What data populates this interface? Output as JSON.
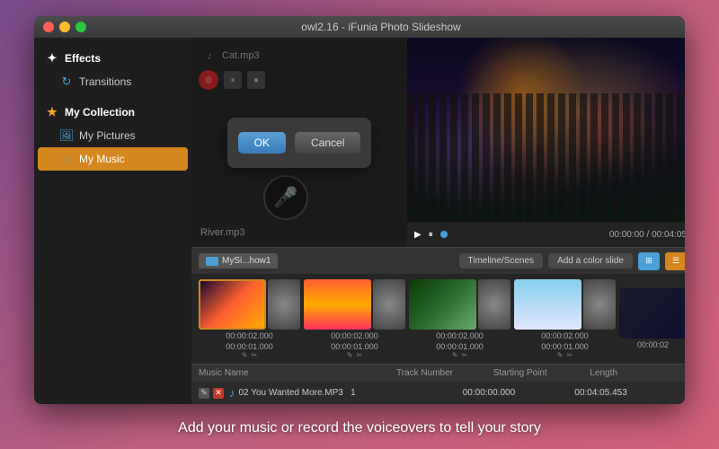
{
  "window": {
    "title": "owl2.16 - iFunia Photo Slideshow"
  },
  "titlebar": {
    "title": "owl2.16 - iFunia Photo Slideshow"
  },
  "sidebar": {
    "effects_label": "Effects",
    "transitions_label": "Transitions",
    "my_collection_label": "My Collection",
    "my_pictures_label": "My Pictures",
    "my_music_label": "My Music"
  },
  "audio": {
    "cat_mp3": "Cat.mp3",
    "river_mp3": "River.mp3"
  },
  "dialog": {
    "ok_label": "OK",
    "cancel_label": "Cancel"
  },
  "preview": {
    "time_display": "00:00:00 / 00:04:05"
  },
  "toolbar": {
    "tab_label": "MySi...how1",
    "timeline_scenes_btn": "Timeline/Scenes",
    "add_color_slide_btn": "Add a color slide"
  },
  "timeline": {
    "thumbs": [
      {
        "time": "00:00:02.000",
        "type": "city"
      },
      {
        "time": "00:00:01.000",
        "type": "blur"
      },
      {
        "time": "00:00:02.000",
        "type": "sunset"
      },
      {
        "time": "00:00:01.000",
        "type": "blur"
      },
      {
        "time": "00:00:02.000",
        "type": "nature"
      },
      {
        "time": "00:00:01.000",
        "type": "blur"
      },
      {
        "time": "00:00:02.000",
        "type": "sky"
      },
      {
        "time": "00:00:01.000",
        "type": "blur"
      }
    ]
  },
  "music_table": {
    "headers": [
      "Music Name",
      "Track Number",
      "Starting Point",
      "Length"
    ],
    "rows": [
      {
        "name": "02 You Wanted More.MP3",
        "track": "1",
        "start": "00:00:00.000",
        "length": "00:04:05.453"
      }
    ]
  },
  "caption": {
    "text": "Add your music or record the voiceovers to tell your story"
  }
}
